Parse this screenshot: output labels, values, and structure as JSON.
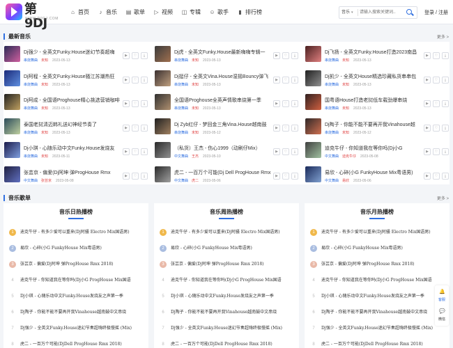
{
  "header": {
    "logo_text": "第9DJ",
    "logo_sub": "WWW.D9DJ.COM",
    "nav": [
      {
        "label": "首页",
        "icon": "home-icon",
        "glyph": "⌂"
      },
      {
        "label": "音乐",
        "icon": "music-note-icon",
        "glyph": "♪"
      },
      {
        "label": "歌单",
        "icon": "playlist-icon",
        "glyph": "▤"
      },
      {
        "label": "视频",
        "icon": "video-icon",
        "glyph": "▷"
      },
      {
        "label": "专辑",
        "icon": "album-icon",
        "glyph": "◫"
      },
      {
        "label": "歌手",
        "icon": "singer-icon",
        "glyph": "☺"
      },
      {
        "label": "排行榜",
        "icon": "chart-icon",
        "glyph": "▮"
      }
    ],
    "search": {
      "type": "音乐",
      "placeholder": "请输入搜索关键词..."
    },
    "auth": {
      "login": "登录",
      "sep": "/",
      "register": "注册"
    }
  },
  "latest": {
    "title": "最新音乐",
    "more": "更多 >",
    "songs": [
      {
        "title": "Dj强少 - 全英文Funky.House迷幻节奏超嗨",
        "genre": "串烧舞曲",
        "artist": "未知",
        "date": "2023-05-13",
        "c1": "#2a2a55",
        "c2": "#d060a0"
      },
      {
        "title": "Dj虎 - 全英文Funky.House最新嗨嗨专辑一",
        "genre": "串烧舞曲",
        "artist": "未知",
        "date": "2023-05-13",
        "c1": "#3a3a3a",
        "c2": "#a07050"
      },
      {
        "title": "Dj飞扬 - 全英文Funky.House打造2023南昌",
        "genre": "串烧舞曲",
        "artist": "未知",
        "date": "2023-05-13",
        "c1": "#4a2020",
        "c2": "#e08080"
      },
      {
        "title": "Dj阿程 - 全英文Funky.House骚江苏潮热狂",
        "genre": "串烧舞曲",
        "artist": "未知",
        "date": "2023-05-13",
        "c1": "#1a2a7a",
        "c2": "#6090e0"
      },
      {
        "title": "Dj挺仔 - 全英文Vina.House湿摇Bouncy弹飞",
        "genre": "串烧舞曲",
        "artist": "未知",
        "date": "2023-05-13",
        "c1": "#3a3030",
        "c2": "#c0a080"
      },
      {
        "title": "Dj凯少 - 全英文House精选珍藏私货串串包",
        "genre": "串烧舞曲",
        "artist": "未知",
        "date": "2023-05-13",
        "c1": "#202020",
        "c2": "#909090"
      },
      {
        "title": "Dj阿成 - 全国语Proghouse精心挑选营销咖啡",
        "genre": "串烧舞曲",
        "artist": "未知",
        "date": "2023-05-13",
        "c1": "#202020",
        "c2": "#c0a060"
      },
      {
        "title": "全国语Proghouse全英声情歌串烧第一季",
        "genre": "串烧舞曲",
        "artist": "未知",
        "date": "2023-05-13",
        "c1": "#303030",
        "c2": "#b09070"
      },
      {
        "title": "国粤语House打造老挝低车载劲爆串烧",
        "genre": "串烧舞曲",
        "artist": "未知",
        "date": "2023-05-13",
        "c1": "#302020",
        "c2": "#d06040"
      },
      {
        "title": "泰国老挝清迈韩礼送幻神经节奏了",
        "genre": "串烧舞曲",
        "artist": "未知",
        "date": "2023-05-13",
        "c1": "#2a4a5a",
        "c2": "#c0d0a0"
      },
      {
        "title": "Dj Zyb红仔 - 梦回金三角Vina.House越南鼓",
        "genre": "串烧舞曲",
        "artist": "未知",
        "date": "2023-05-12",
        "c1": "#202020",
        "c2": "#a08060"
      },
      {
        "title": "Dj陶子 - 你能不能不要再开我Vinahouse越",
        "genre": "串烧舞曲",
        "artist": "未知",
        "date": "2023-05-12",
        "c1": "#302828",
        "c2": "#d07050"
      },
      {
        "title": "Dj小琪 - 心随乐动中文Funky.House发烧友",
        "genre": "串烧舞曲",
        "artist": "未知",
        "date": "2023-05-11",
        "c1": "#1a1a4a",
        "c2": "#80a0e0"
      },
      {
        "title": "（私货）王杰 - 伤心1999（动刷仔Mix）",
        "genre": "中文舞曲",
        "artist": "王杰",
        "date": "2023-05-10",
        "c1": "#2a2a2a",
        "c2": "#909090"
      },
      {
        "title": "迪克牛仔 - 你知道我在等你吗(Dj小G",
        "genre": "中文舞曲",
        "artist": "迪克牛仔",
        "date": "2023-05-08",
        "c1": "#404040",
        "c2": "#a0c0a0"
      },
      {
        "title": "张芸京 - 偏爱(Dj阿坤 弹ProgHouse Rmx",
        "genre": "中文舞曲",
        "artist": "张芸京",
        "date": "2023-05-08",
        "c1": "#202040",
        "c2": "#6070c0"
      },
      {
        "title": "虎二 - 一百万个可能(Dj Dell ProgHouse Rmx",
        "genre": "中文舞曲",
        "artist": "虎二",
        "date": "2023-05-06",
        "c1": "#2a2a2a",
        "c2": "#a0a0a0"
      },
      {
        "title": "易欣 - 心碎(小G FunkyHouse Mix粤语男)",
        "genre": "中文舞曲",
        "artist": "易欣",
        "date": "2023-05-06",
        "c1": "#1a2a5a",
        "c2": "#80a0d0"
      }
    ]
  },
  "playlists": {
    "title": "音乐歌单",
    "more": "更多 >",
    "charts": [
      {
        "title": "音乐日热播榜",
        "items": [
          "迪克牛仔 - 有多少爱可以重来(Dj阿骚 Electro Mix国语男)",
          "易欣 - 心碎(小G FunkyHouse Mix粤语男)",
          "张芸京 - 偏爱(Dj阿坤 弹ProgHouse Rmx 2018)",
          "迪克牛仔 - 你知道我在等你吗(Dj小G ProgHouse Mix国语",
          "Dj小琪 - 心随乐动中文Funky.House发烧友之声第一季",
          "Dj陶子 - 你能不能不要再开我Vinahouse越南鼓中文串烧",
          "Dj强少 - 全英文Funky.House迷幻节奏超嗨终极慢摇 (Mix)",
          "虎二 - 一百万个可能(DjDell ProgHouse Rmx 2018)"
        ]
      },
      {
        "title": "音乐周热播榜",
        "items": [
          "迪克牛仔 - 有多少爱可以重来(Dj阿骚 Electro Mix国语男)",
          "易欣 - 心碎(小G FunkyHouse Mix粤语男)",
          "张芸京 - 偏爱(Dj阿坤 弹ProgHouse Rmx 2018)",
          "迪克牛仔 - 你知道我在等你吗(Dj小G ProgHouse Mix国语",
          "Dj小琪 - 心随乐动中文Funky.House发烧友之声第一季",
          "Dj陶子 - 你能不能不要再开我Vinahouse越南鼓中文串烧",
          "Dj强少 - 全英文Funky.House迷幻节奏超嗨终极慢摇 (Mix)",
          "虎二 - 一百万个可能(DjDell ProgHouse Rmx 2018)"
        ]
      },
      {
        "title": "音乐月热播榜",
        "items": [
          "迪克牛仔 - 有多少爱可以重来(Dj阿骚 Electro Mix国语男)",
          "易欣 - 心碎(小G FunkyHouse Mix粤语男)",
          "张芸京 - 偏爱(Dj阿坤 弹ProgHouse Rmx 2018)",
          "迪克牛仔 - 你知道我在等你吗(Dj小G ProgHouse Mix国语",
          "Dj小琪 - 心随乐动中文Funky.House发烧友之声第一季",
          "Dj陶子 - 你能不能不要再开我Vinahouse越南鼓中文串烧",
          "Dj强少 - 全英文Funky.House迷幻节奏超嗨终极慢摇 (Mix)",
          "虎二 - 一百万个可能(DjDell ProgHouse Rmx 2018)"
        ]
      }
    ]
  },
  "float_bar": {
    "items": [
      {
        "label": "客服",
        "icon": "service-icon",
        "glyph": "🔔"
      },
      {
        "label": "微信",
        "icon": "wechat-icon",
        "glyph": "💬"
      }
    ]
  }
}
